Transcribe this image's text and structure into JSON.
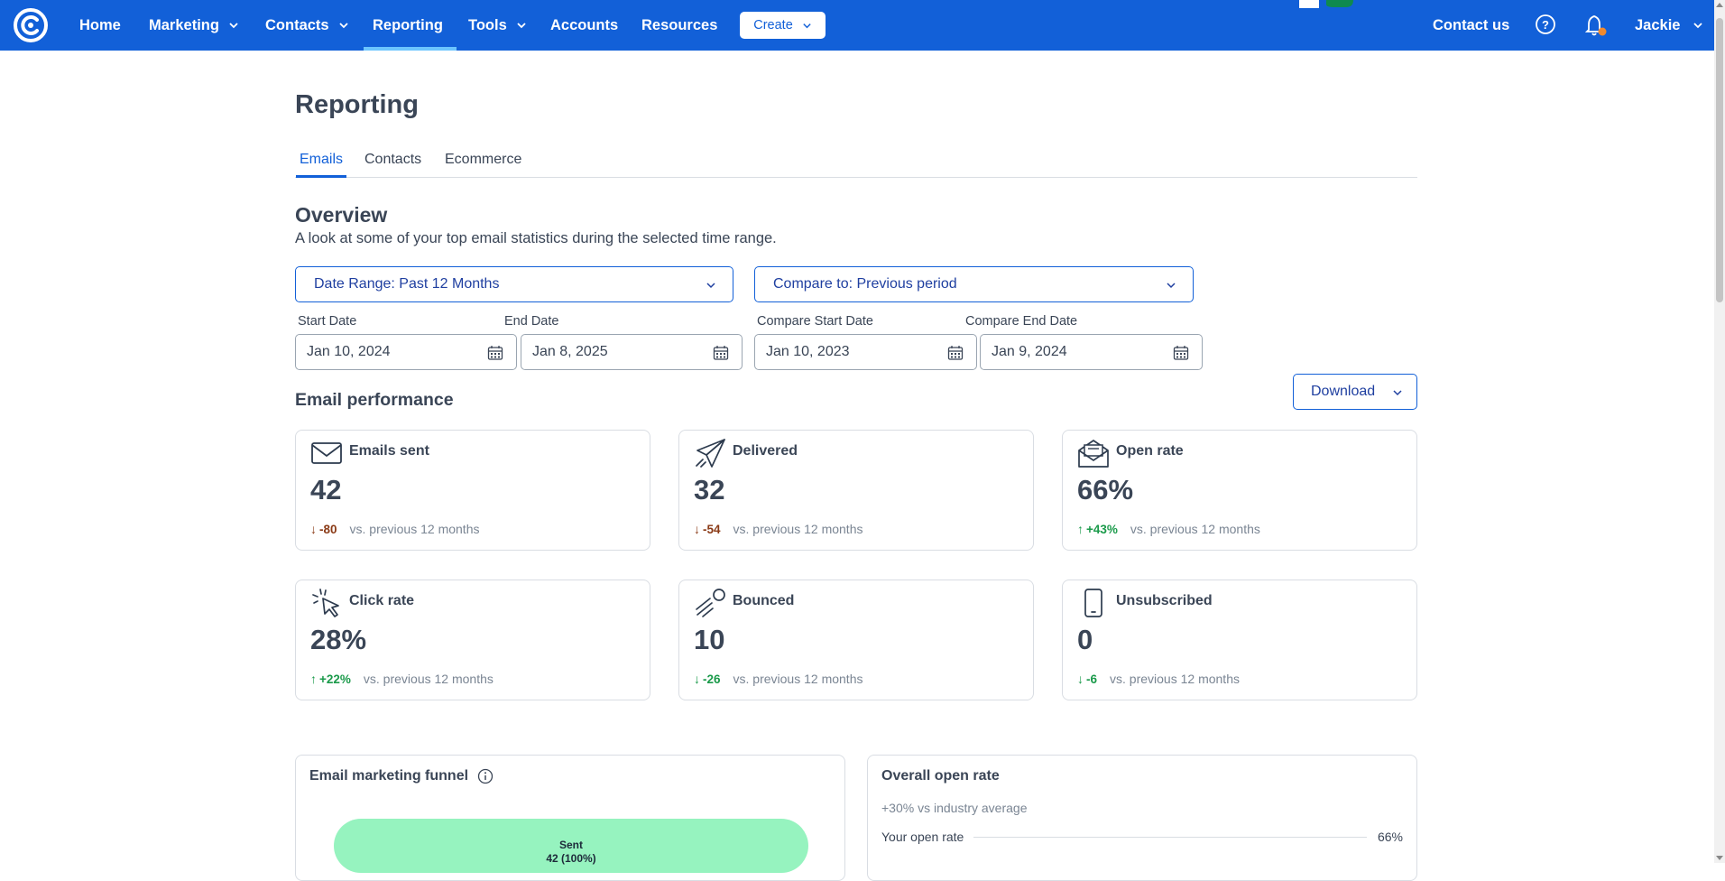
{
  "nav": {
    "items": [
      {
        "label": "Home",
        "has_menu": false
      },
      {
        "label": "Marketing",
        "has_menu": true
      },
      {
        "label": "Contacts",
        "has_menu": true
      },
      {
        "label": "Reporting",
        "has_menu": false,
        "active": true
      },
      {
        "label": "Tools",
        "has_menu": true
      },
      {
        "label": "Accounts",
        "has_menu": false
      },
      {
        "label": "Resources",
        "has_menu": false
      }
    ],
    "create_label": "Create",
    "contact_label": "Contact us",
    "user_label": "Jackie",
    "colors": {
      "bar": "#1260d8",
      "active_underline": "#6cc5ff",
      "notification_dot": "#f0892e"
    }
  },
  "page": {
    "title": "Reporting",
    "tabs": [
      "Emails",
      "Contacts",
      "Ecommerce"
    ],
    "active_tab": "Emails"
  },
  "overview": {
    "title": "Overview",
    "subtitle": "A look at some of your top email statistics during the selected time range.",
    "date_range_select": "Date Range: Past 12 Months",
    "compare_select": "Compare to: Previous period",
    "start_date_label": "Start Date",
    "start_date": "Jan 10, 2024",
    "end_date_label": "End Date",
    "end_date": "Jan 8, 2025",
    "compare_start_label": "Compare Start Date",
    "compare_start": "Jan 10, 2023",
    "compare_end_label": "Compare End Date",
    "compare_end": "Jan 9, 2024"
  },
  "performance": {
    "title": "Email performance",
    "download_label": "Download",
    "cards": [
      {
        "title": "Emails sent",
        "icon": "envelope-icon",
        "value": "42",
        "delta": "-80",
        "direction": "down",
        "tone": "negative",
        "compare": "vs. previous 12 months"
      },
      {
        "title": "Delivered",
        "icon": "paper-plane-icon",
        "value": "32",
        "delta": "-54",
        "direction": "down",
        "tone": "negative",
        "compare": "vs. previous 12 months"
      },
      {
        "title": "Open rate",
        "icon": "open-envelope-icon",
        "value": "66%",
        "delta": "+43%",
        "direction": "up",
        "tone": "positive",
        "compare": "vs. previous 12 months"
      },
      {
        "title": "Click rate",
        "icon": "cursor-click-icon",
        "value": "28%",
        "delta": "+22%",
        "direction": "up",
        "tone": "positive",
        "compare": "vs. previous 12 months"
      },
      {
        "title": "Bounced",
        "icon": "bounce-ball-icon",
        "value": "10",
        "delta": "-26",
        "direction": "down",
        "tone": "positive",
        "compare": "vs. previous 12 months"
      },
      {
        "title": "Unsubscribed",
        "icon": "mobile-icon",
        "value": "0",
        "delta": "-6",
        "direction": "down",
        "tone": "positive",
        "compare": "vs. previous 12 months"
      }
    ]
  },
  "funnel": {
    "title": "Email marketing funnel",
    "bar_label": "Sent",
    "bar_value": "42 (100%)",
    "bar_color": "#96f3bf"
  },
  "open_rate_panel": {
    "title": "Overall open rate",
    "subtitle": "+30% vs industry average",
    "row_label": "Your open rate",
    "row_value": "66%"
  }
}
